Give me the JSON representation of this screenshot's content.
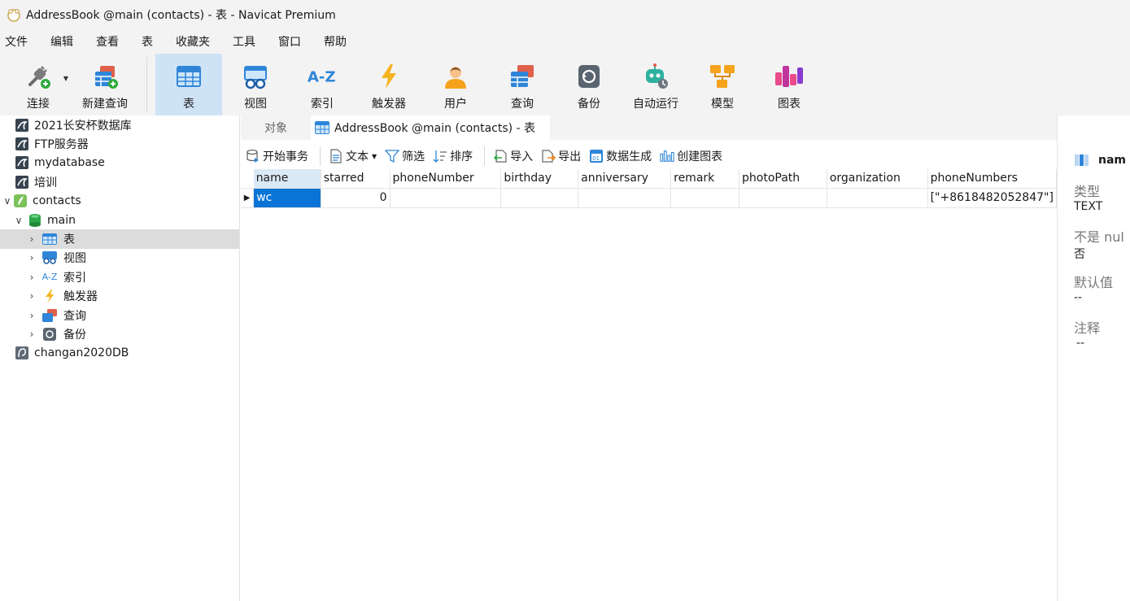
{
  "window": {
    "title": "AddressBook @main (contacts) - 表 - Navicat Premium"
  },
  "menu": [
    "文件",
    "编辑",
    "查看",
    "表",
    "收藏夹",
    "工具",
    "窗口",
    "帮助"
  ],
  "toolbar": {
    "buttons": [
      {
        "label": "连接",
        "icon": "plug-icon"
      },
      {
        "label": "新建查询",
        "icon": "new-query-icon"
      },
      {
        "label": "表",
        "icon": "table-icon"
      },
      {
        "label": "视图",
        "icon": "view-icon"
      },
      {
        "label": "索引",
        "icon": "index-icon"
      },
      {
        "label": "触发器",
        "icon": "trigger-icon"
      },
      {
        "label": "用户",
        "icon": "user-icon"
      },
      {
        "label": "查询",
        "icon": "query-icon"
      },
      {
        "label": "备份",
        "icon": "backup-icon"
      },
      {
        "label": "自动运行",
        "icon": "robot-icon"
      },
      {
        "label": "模型",
        "icon": "model-icon"
      },
      {
        "label": "图表",
        "icon": "chart-icon"
      }
    ]
  },
  "tree": {
    "items": [
      {
        "label": "2021长安杯数据库"
      },
      {
        "label": "FTP服务器"
      },
      {
        "label": "mydatabase"
      },
      {
        "label": "培训"
      },
      {
        "label": "contacts"
      },
      {
        "label": "main"
      },
      {
        "label": "表"
      },
      {
        "label": "视图"
      },
      {
        "label": "索引"
      },
      {
        "label": "触发器"
      },
      {
        "label": "查询"
      },
      {
        "label": "备份"
      },
      {
        "label": "changan2020DB"
      }
    ]
  },
  "tabs": {
    "objects": "对象",
    "active": "AddressBook @main (contacts) - 表"
  },
  "datatools": {
    "begin_tx": "开始事务",
    "text": "文本",
    "filter": "筛选",
    "sort": "排序",
    "import": "导入",
    "export": "导出",
    "gen_data": "数据生成",
    "create_chart": "创建图表"
  },
  "grid": {
    "columns": [
      "name",
      "starred",
      "phoneNumber",
      "birthday",
      "anniversary",
      "remark",
      "photoPath",
      "organization",
      "phoneNumbers"
    ],
    "rows": [
      [
        "wc",
        "0",
        "",
        "",
        "",
        "",
        "",
        "",
        "[\"+8618482052847\"]"
      ]
    ]
  },
  "info": {
    "field": "nam",
    "type_label": "类型",
    "type_value": "TEXT",
    "notnull_label": "不是 nul",
    "notnull_value": "否",
    "default_label": "默认值",
    "default_value": "--",
    "comment_label": "注释",
    "comment_value": "--"
  }
}
